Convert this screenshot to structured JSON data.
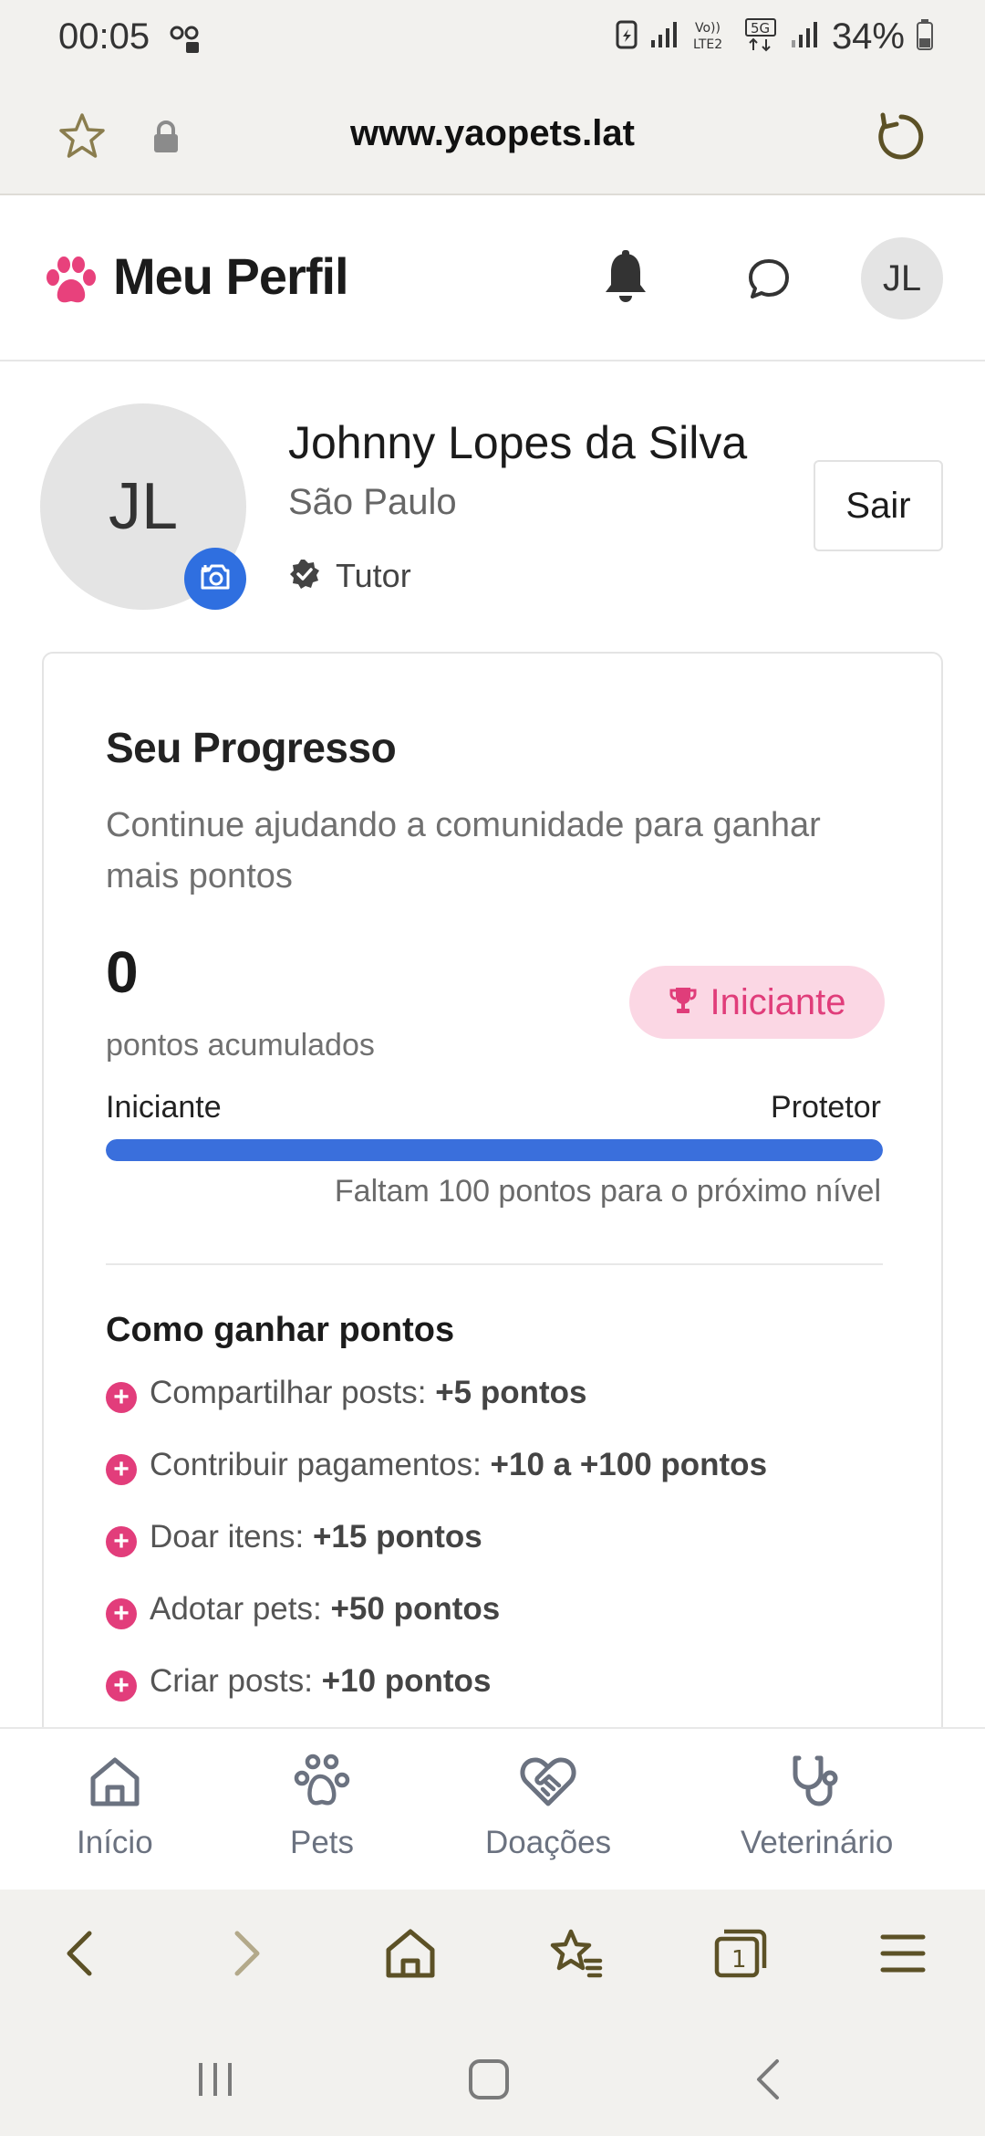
{
  "status_bar": {
    "time": "00:05",
    "battery_percent": "34%",
    "icons": [
      "sim-icon",
      "signal-icon",
      "volte-icon",
      "5g-icon",
      "signal-icon",
      "battery-icon"
    ]
  },
  "browser": {
    "url": "www.yaopets.lat",
    "icons": [
      "star-icon",
      "lock-icon",
      "reload-icon"
    ]
  },
  "header": {
    "title": "Meu Perfil",
    "avatar_initials": "JL",
    "icons": [
      "paw-icon",
      "bell-icon",
      "chat-icon"
    ]
  },
  "profile": {
    "initials": "JL",
    "name": "Johnny Lopes da Silva",
    "city": "São Paulo",
    "role": "Tutor",
    "logout_label": "Sair"
  },
  "progress": {
    "title": "Seu Progresso",
    "subtitle": "Continue ajudando a comunidade para ganhar mais pontos",
    "points": "0",
    "points_label": "pontos acumulados",
    "level_badge": "Iniciante",
    "level_from": "Iniciante",
    "level_to": "Protetor",
    "progress_fraction": 1.0,
    "note": "Faltam 100 pontos para o próximo nível",
    "earn_title": "Como ganhar pontos",
    "earn_items": [
      {
        "action": "Compartilhar posts:",
        "reward": "+5 pontos"
      },
      {
        "action": "Contribuir pagamentos:",
        "reward": "+10 a +100 pontos"
      },
      {
        "action": "Doar itens:",
        "reward": "+15 pontos"
      },
      {
        "action": "Adotar pets:",
        "reward": "+50 pontos"
      },
      {
        "action": "Criar posts:",
        "reward": "+10 pontos"
      }
    ]
  },
  "bottom_nav": {
    "items": [
      {
        "label": "Início",
        "icon": "home-icon"
      },
      {
        "label": "Pets",
        "icon": "paw-icon"
      },
      {
        "label": "Doações",
        "icon": "heart-handshake-icon"
      },
      {
        "label": "Veterinário",
        "icon": "stethoscope-icon"
      }
    ]
  },
  "browser_toolbar": {
    "tab_count": "1",
    "icons": [
      "back-icon",
      "forward-icon",
      "home-icon",
      "bookmarks-icon",
      "tabs-icon",
      "menu-icon"
    ]
  },
  "colors": {
    "accent_pink": "#e23d7b",
    "badge_pink_bg": "#fbd7e4",
    "progress_blue": "#3a6fdc",
    "camera_blue": "#2f6fe0",
    "browser_olive": "#5c5126"
  }
}
